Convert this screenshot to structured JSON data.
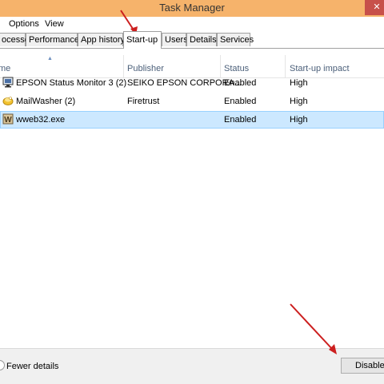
{
  "window": {
    "title": "Task Manager",
    "close_glyph": "✕"
  },
  "menu": [
    "Options",
    "View"
  ],
  "tabs": [
    {
      "label": "ocesses"
    },
    {
      "label": "Performance"
    },
    {
      "label": "App history"
    },
    {
      "label": "Start-up",
      "active": true
    },
    {
      "label": "Users"
    },
    {
      "label": "Details"
    },
    {
      "label": "Services"
    }
  ],
  "table": {
    "columns": [
      "me",
      "Publisher",
      "Status",
      "Start-up impact"
    ],
    "sort_glyph": "▲",
    "rows": [
      {
        "icon": "monitor-icon",
        "name": "EPSON Status Monitor 3 (2)",
        "publisher": "SEIKO EPSON CORPORA...",
        "status": "Enabled",
        "impact": "High"
      },
      {
        "icon": "mailwasher-icon",
        "name": "MailWasher (2)",
        "publisher": "Firetrust",
        "status": "Enabled",
        "impact": "High"
      },
      {
        "icon": "w-app-icon",
        "name": "wweb32.exe",
        "publisher": "",
        "status": "Enabled",
        "impact": "High",
        "selected": true
      }
    ]
  },
  "footer": {
    "fewer_details": "Fewer details",
    "disable_label": "Disable"
  },
  "colors": {
    "titlebar": "#f6b36b",
    "selection": "#cce8ff",
    "annotation_arrow": "#cc1f1f"
  }
}
